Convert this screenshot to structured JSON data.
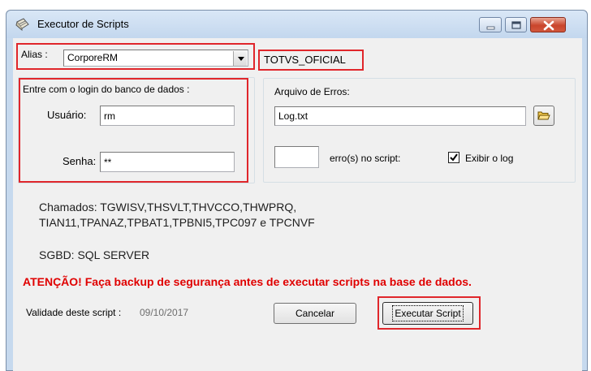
{
  "window": {
    "title": "Executor de Scripts"
  },
  "alias": {
    "label": "Alias :",
    "value": "CorporeRM",
    "database": "TOTVS_OFICIAL"
  },
  "login": {
    "title": "Entre com o login do banco de dados :",
    "user_label": "Usuário:",
    "user_value": "rm",
    "password_label": "Senha:",
    "password_value": "**"
  },
  "errors": {
    "title": "Arquivo de Erros:",
    "file_value": "Log.txt",
    "count_value": "",
    "count_suffix": "erro(s) no script:",
    "show_log_label": "Exibir o log",
    "show_log_checked": true
  },
  "info": {
    "chamados_line1": "Chamados: TGWISV,THSVLT,THVCCO,THWPRQ,",
    "chamados_line2": "TIAN11,TPANAZ,TPBAT1,TPBNI5,TPC097 e TPCNVF",
    "sgbd": "SGBD: SQL SERVER",
    "warning": "ATENÇÃO! Faça backup de segurança antes de executar scripts na base de dados.",
    "validity_label": "Validade deste script :",
    "validity_date": "09/10/2017"
  },
  "buttons": {
    "cancel": "Cancelar",
    "execute": "Executar Script"
  },
  "colors": {
    "highlight": "#e0262b",
    "warning_text": "#e00000",
    "date_text": "#6d6d6d"
  }
}
